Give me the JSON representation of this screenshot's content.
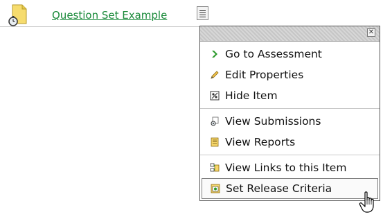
{
  "item": {
    "title": "Question Set Example",
    "icon": "assessment-icon"
  },
  "menu": {
    "trigger_icon": "chevron-down-icon",
    "close_glyph": "✕",
    "groups": [
      [
        {
          "label": "Go to Assessment",
          "icon": "arrow-right-icon"
        },
        {
          "label": "Edit Properties",
          "icon": "pencil-icon"
        },
        {
          "label": "Hide Item",
          "icon": "hide-icon"
        }
      ],
      [
        {
          "label": "View Submissions",
          "icon": "submissions-icon"
        },
        {
          "label": "View Reports",
          "icon": "reports-icon"
        }
      ],
      [
        {
          "label": "View Links to this Item",
          "icon": "links-icon"
        },
        {
          "label": "Set Release Criteria",
          "icon": "release-criteria-icon",
          "hovered": true
        }
      ]
    ]
  },
  "colors": {
    "link": "#1a8a3a",
    "menu_border": "#555555"
  }
}
